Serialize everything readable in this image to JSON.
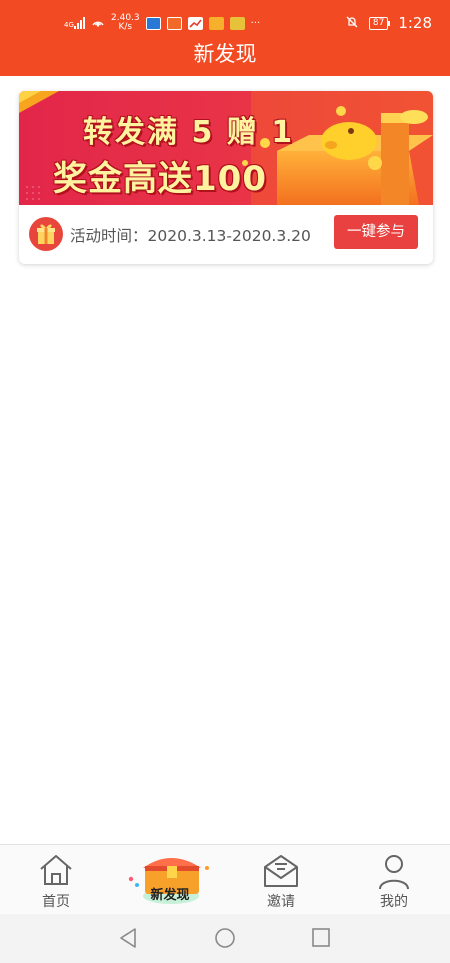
{
  "status_bar": {
    "network_type": "4G",
    "net_speed_value": "2.40.3",
    "net_speed_unit": "K/s",
    "battery": "87",
    "time": "1:28",
    "more": "···"
  },
  "header": {
    "title": "新发现"
  },
  "activity": {
    "banner_line1": "转发满 5 赠 1",
    "banner_line2": "奖金高送100",
    "time_text": "活动时间：2020.3.13-2020.3.20",
    "join_label": "一键参与"
  },
  "tabbar": {
    "tabs": [
      {
        "label": "首页",
        "icon": "home-icon"
      },
      {
        "label": "新发现",
        "icon": "treasure-chest-icon"
      },
      {
        "label": "邀请",
        "icon": "mail-icon"
      },
      {
        "label": "我的",
        "icon": "user-icon"
      }
    ]
  },
  "system_nav": {
    "buttons": [
      "back-icon",
      "home-circle-icon",
      "recents-icon"
    ]
  },
  "colors": {
    "brand": "#f24b23",
    "button": "#e8413f"
  }
}
